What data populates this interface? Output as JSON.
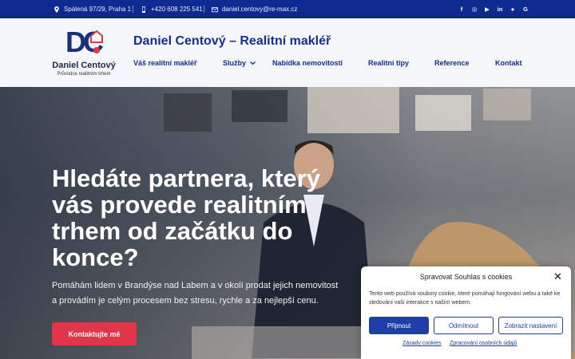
{
  "topbar": {
    "address": "Spálená 97/29, Praha 1",
    "phone": "+420 608 225 541",
    "email": "daniel.centovy@re-max.cz",
    "social": [
      "f",
      "◎",
      "▶",
      "in",
      "●",
      "G"
    ]
  },
  "logo": {
    "monogram": "DC",
    "name": "Daniel Centový",
    "tagline": "Průvodce realitním trhem"
  },
  "header": {
    "site_title": "Daniel Centový – Realitní makléř"
  },
  "nav": {
    "items": [
      {
        "label": "Váš realitní makléř"
      },
      {
        "label": "Služby"
      },
      {
        "label": "Nabídka nemovitostí"
      },
      {
        "label": "Realitní tipy"
      },
      {
        "label": "Reference"
      },
      {
        "label": "Kontakt"
      }
    ]
  },
  "hero": {
    "title": "Hledáte partnera, který vás provede realitním trhem od začátku do konce?",
    "text": "Pomáhám lidem v Brandýse nad Labem a v okolí prodat jejich nemovitost a provádím je celým procesem bez stresu, rychle a za nejlepší cenu.",
    "button": "Kontaktujte mě"
  },
  "cookie": {
    "title": "Spravovat Souhlas s cookies",
    "text": "Tento web používá soubory cookie, které pomáhají fungování webu a také ke sledování vaší interakce s naším webem.",
    "accept": "Přijmout",
    "deny": "Odmítnout",
    "settings": "Zobrazit nastavení",
    "link_cookies": "Zásady cookies",
    "link_privacy": "Zpracování osobních údajů",
    "close": "✕"
  },
  "colors": {
    "brand_blue": "#14308f",
    "topbar": "#0f2a8f",
    "cta_red": "#e2354a"
  }
}
